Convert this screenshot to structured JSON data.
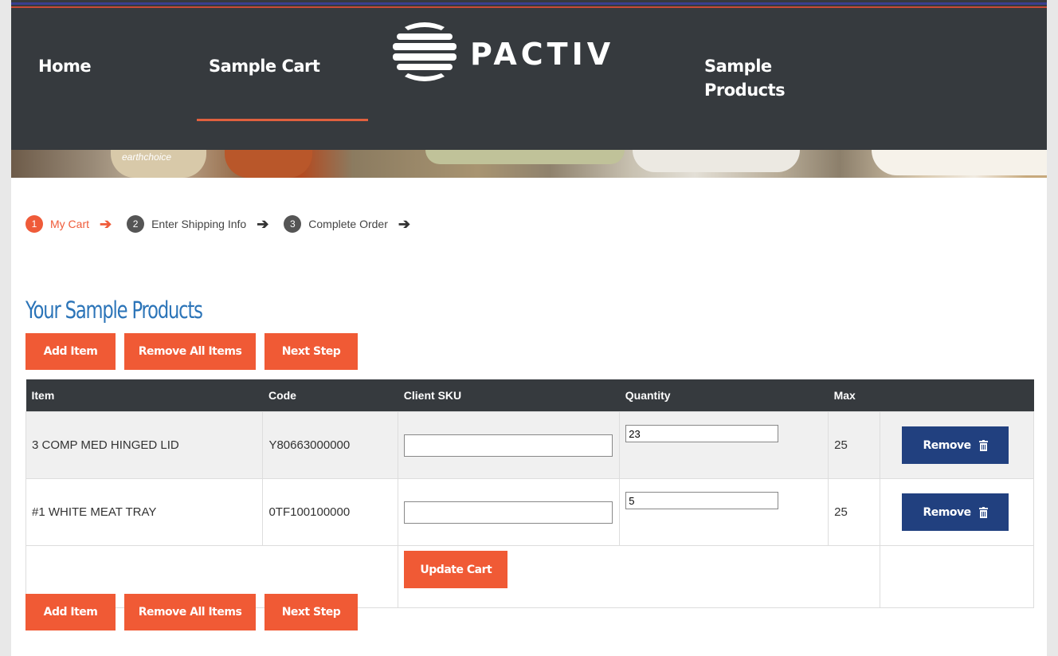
{
  "nav": {
    "home": "Home",
    "sample_cart": "Sample Cart",
    "logo_text": "PACTIV",
    "sample_products_line1": "Sample",
    "sample_products_line2": "Products"
  },
  "banner": {
    "label": "earthchoice"
  },
  "steps": [
    {
      "num": "1",
      "label": "My Cart",
      "active": true
    },
    {
      "num": "2",
      "label": "Enter Shipping Info",
      "active": false
    },
    {
      "num": "3",
      "label": "Complete Order",
      "active": false
    }
  ],
  "title": "Your Sample Products",
  "buttons": {
    "add_item": "Add Item",
    "remove_all": "Remove All Items",
    "next_step": "Next Step"
  },
  "table": {
    "headers": [
      "Item",
      "Code",
      "Client SKU",
      "Quantity",
      "Max",
      ""
    ],
    "rows": [
      {
        "item": "3 COMP MED HINGED LID",
        "code": "Y80663000000",
        "client_sku": "",
        "quantity": "23",
        "max": "25",
        "remove_label": "Remove"
      },
      {
        "item": "#1 WHITE MEAT TRAY",
        "code": "0TF100100000",
        "client_sku": "",
        "quantity": "5",
        "max": "25",
        "remove_label": "Remove"
      }
    ],
    "update_label": "Update Cart"
  },
  "colors": {
    "accent": "#f05a35",
    "nav_bg": "#363a3e",
    "title": "#2b74b8",
    "remove_btn": "#21407f"
  }
}
